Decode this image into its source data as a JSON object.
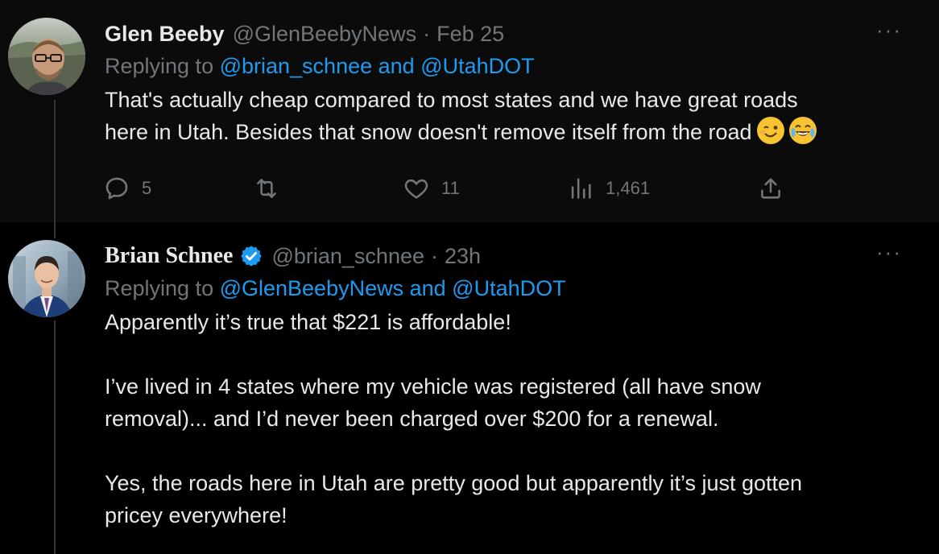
{
  "tweets": [
    {
      "display_name": "Glen Beeby",
      "handle": "@GlenBeebyNews",
      "separator": "·",
      "time": "Feb 25",
      "more_label": "···",
      "replying_prefix": "Replying to ",
      "reply_mention_1": "@brian_schnee",
      "reply_and": " and ",
      "reply_mention_2": "@UtahDOT",
      "body": "That's actually cheap compared to most states and we have great roads\nhere in Utah. Besides that snow doesn't remove itself from the road",
      "emojis": [
        "winking-face",
        "face-with-tears-of-joy"
      ],
      "actions": {
        "replies": "5",
        "retweets": "",
        "likes": "11",
        "views": "1,461"
      }
    },
    {
      "display_name": "Brian Schnee",
      "verified": true,
      "handle": "@brian_schnee",
      "separator": "·",
      "time": "23h",
      "more_label": "···",
      "replying_prefix": "Replying to ",
      "reply_mention_1": "@GlenBeebyNews",
      "reply_and": " and ",
      "reply_mention_2": "@UtahDOT",
      "body": "Apparently it’s true that $221 is affordable!\n\nI’ve lived in 4 states where my vehicle was registered (all have snow\nremoval)... and I’d never been charged over $200 for a renewal.\n\nYes, the roads here in Utah are pretty good but apparently it’s just gotten\npricey everywhere!"
    }
  ],
  "colors": {
    "background": "#000000",
    "first_tweet_background": "#0b0b0b",
    "text": "#e7e9ea",
    "secondary_text": "#71767b",
    "link": "#1d9bf0",
    "verified": "#1d9bf0",
    "thread_line": "#333639"
  },
  "icons": {
    "reply": "reply-bubble-icon",
    "retweet": "retweet-icon",
    "like": "heart-icon",
    "views": "views-bar-chart-icon",
    "share": "share-upload-icon",
    "more": "more-dots-icon",
    "verified": "verified-badge-icon"
  }
}
